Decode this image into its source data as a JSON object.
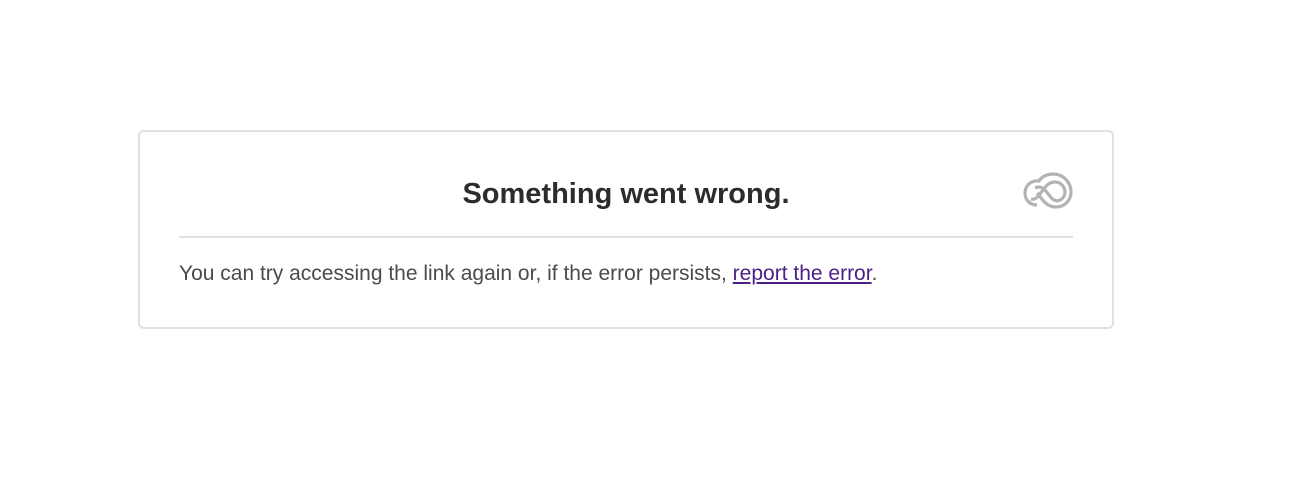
{
  "dialog": {
    "title": "Something went wrong.",
    "logo_icon": "creative-cloud-icon",
    "message_prefix": "You can try accessing the link again or, if the error persists, ",
    "link_label": "report the error",
    "message_suffix": ".",
    "colors": {
      "link": "#4b1f85",
      "title": "#2c2c2c",
      "text": "#4b4b4b",
      "border": "#e1e1e1",
      "logo": "#b3b3b3"
    }
  }
}
